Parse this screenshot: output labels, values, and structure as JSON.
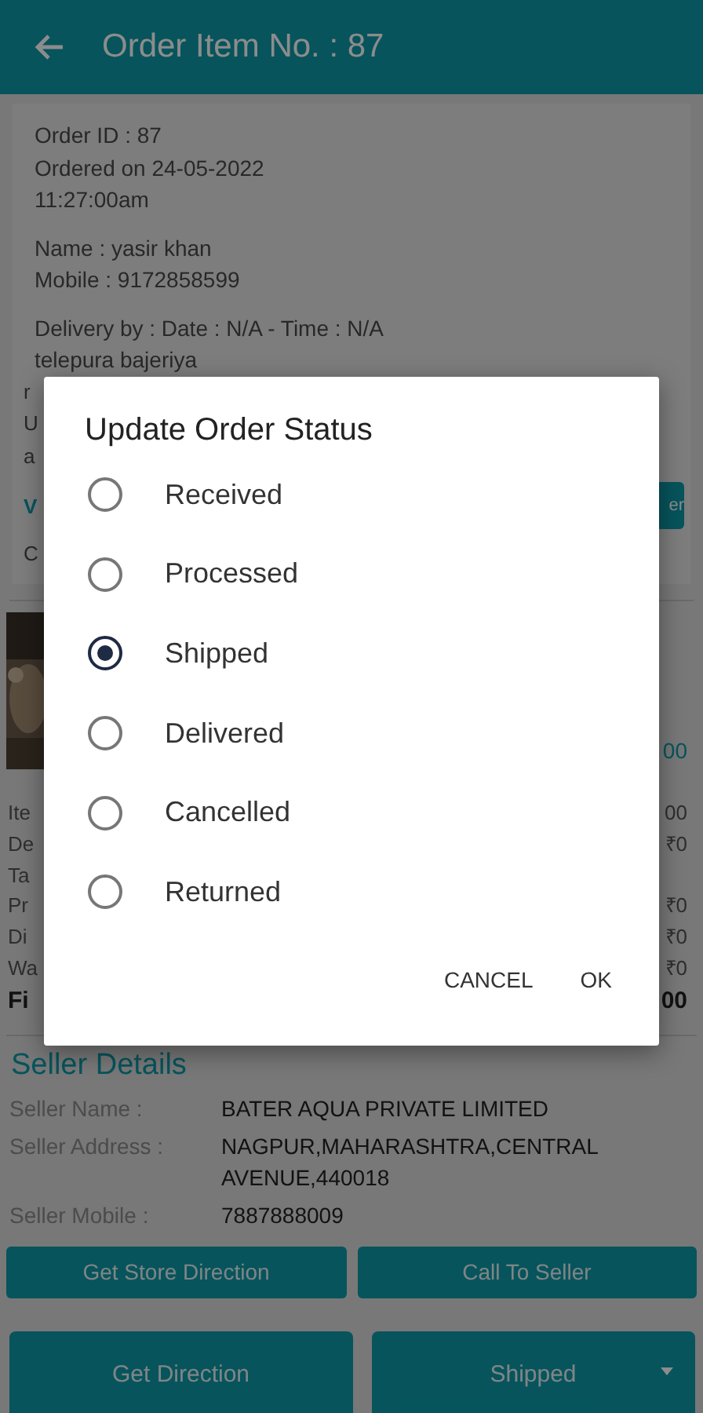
{
  "app_bar": {
    "title": "Order Item No. : 87"
  },
  "order_card": {
    "groups": [
      [
        "Order ID : 87",
        "Ordered on 24-05-2022",
        "11:27:00am"
      ],
      [
        "Name : yasir khan",
        "Mobile : 9172858599"
      ],
      [
        "Delivery by : Date : N/A - Time : N/A",
        "telepura bajeriya"
      ]
    ],
    "address_fragments": [
      "r",
      "U",
      "a"
    ],
    "link_fragment": "V",
    "button_fragment": "er",
    "note_fragment": "C"
  },
  "product": {
    "price_fragment": "00"
  },
  "charges": [
    {
      "kind": "line",
      "label": "Ite",
      "value": "00"
    },
    {
      "kind": "line",
      "label": "De",
      "value": "₹0"
    },
    {
      "kind": "line",
      "label": "Ta"
    },
    {
      "kind": "line",
      "label": "Pr",
      "value": "₹0"
    },
    {
      "kind": "line",
      "label": "Di",
      "value": "₹0"
    },
    {
      "kind": "line",
      "label": "Wa",
      "value": "₹0"
    },
    {
      "kind": "total",
      "label": "Fi",
      "value": "00"
    }
  ],
  "seller": {
    "heading": "Seller Details",
    "rows": [
      {
        "label": "Seller Name :",
        "value": "BATER AQUA PRIVATE LIMITED"
      },
      {
        "label": "Seller Address :",
        "value": "NAGPUR,MAHARASHTRA,CENTRAL AVENUE,440018"
      },
      {
        "label": "Seller Mobile :",
        "value": "7887888009"
      }
    ]
  },
  "seller_buttons": [
    "Get Store Direction",
    "Call To Seller"
  ],
  "bottom_bar": {
    "direction_button": "Get Direction",
    "status_dropdown": "Shipped"
  },
  "dialog": {
    "title": "Update Order Status",
    "options": [
      {
        "label": "Received",
        "selected": false
      },
      {
        "label": "Processed",
        "selected": false
      },
      {
        "label": "Shipped",
        "selected": true
      },
      {
        "label": "Delivered",
        "selected": false
      },
      {
        "label": "Cancelled",
        "selected": false
      },
      {
        "label": "Returned",
        "selected": false
      }
    ],
    "buttons": [
      "CANCEL",
      "OK"
    ]
  }
}
